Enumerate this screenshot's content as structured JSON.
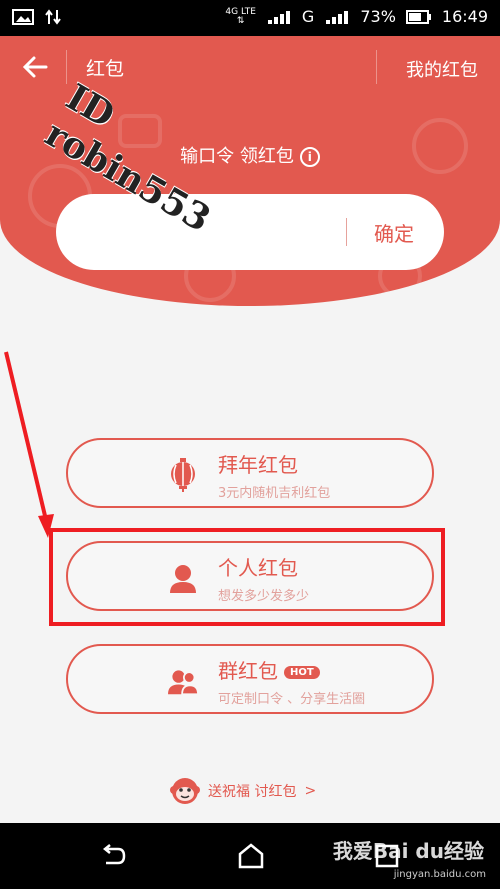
{
  "status": {
    "network": "4G LTE",
    "carrier_g": "G",
    "battery": "73%",
    "time": "16:49"
  },
  "header": {
    "title": "红包",
    "my_hongbao": "我的红包",
    "command_label": "输口令 领红包",
    "confirm": "确定",
    "input_placeholder": ""
  },
  "options": [
    {
      "title": "拜年红包",
      "subtitle": "3元内随机吉利红包",
      "icon": "lantern-icon"
    },
    {
      "title": "个人红包",
      "subtitle": "想发多少发多少",
      "icon": "person-icon"
    },
    {
      "title": "群红包",
      "badge": "HOT",
      "subtitle": "可定制口令 、分享生活圈",
      "icon": "group-icon"
    }
  ],
  "footer_link": {
    "text": "送祝福 讨红包",
    "chevron": ">"
  },
  "watermark": {
    "text": "ID robin553"
  },
  "baidu": {
    "text": "我爱Bai du经验",
    "url": "jingyan.baidu.com"
  },
  "colors": {
    "primary": "#e2594f",
    "highlight": "#ee1d22"
  }
}
